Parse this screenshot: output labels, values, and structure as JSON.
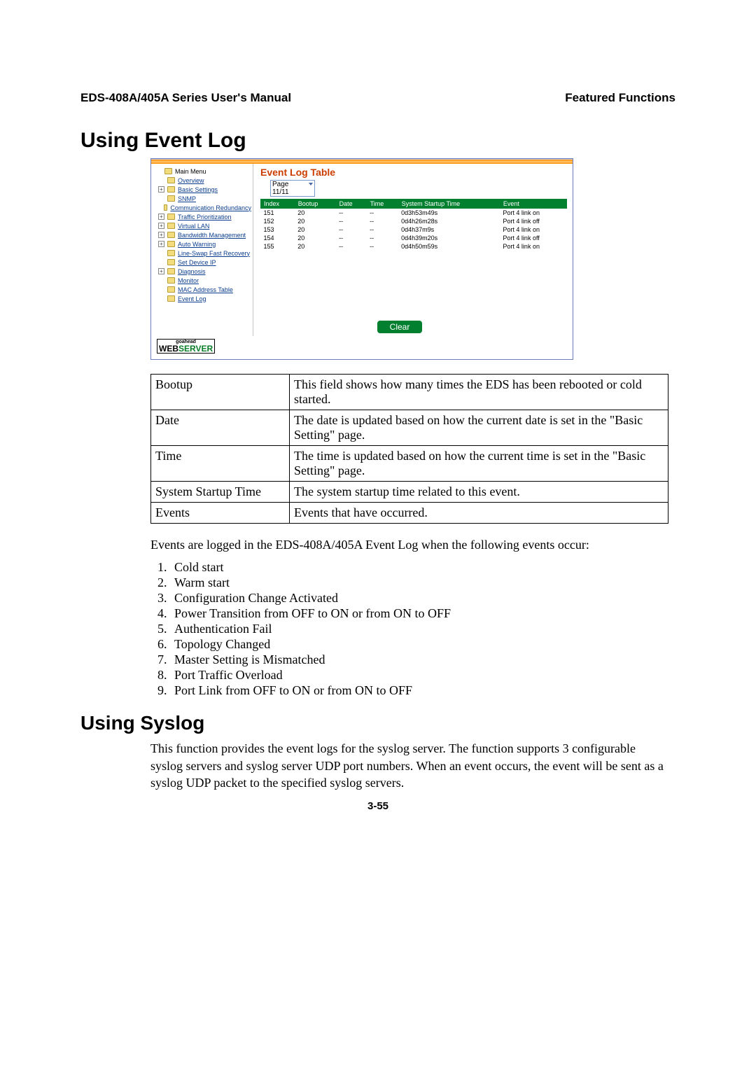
{
  "header": {
    "left": "EDS-408A/405A Series User's Manual",
    "right": "Featured Functions"
  },
  "h1": "Using Event Log",
  "screenshot": {
    "tree": [
      {
        "label": "Main Menu",
        "black": true,
        "exp": null,
        "indent": 0
      },
      {
        "label": "Overview",
        "exp": null,
        "indent": 1
      },
      {
        "label": "Basic Settings",
        "exp": "+",
        "indent": 1
      },
      {
        "label": "SNMP",
        "exp": null,
        "indent": 1
      },
      {
        "label": "Communication Redundancy",
        "exp": null,
        "indent": 1
      },
      {
        "label": "Traffic Prioritization",
        "exp": "+",
        "indent": 1
      },
      {
        "label": "Virtual LAN",
        "exp": "+",
        "indent": 1
      },
      {
        "label": "Bandwidth Management",
        "exp": "+",
        "indent": 1
      },
      {
        "label": "Auto Warning",
        "exp": "+",
        "indent": 1
      },
      {
        "label": "Line-Swap Fast Recovery",
        "exp": null,
        "indent": 1
      },
      {
        "label": "Set Device IP",
        "exp": null,
        "indent": 1
      },
      {
        "label": "Diagnosis",
        "exp": "+",
        "indent": 1
      },
      {
        "label": "Monitor",
        "exp": null,
        "indent": 1
      },
      {
        "label": "MAC Address Table",
        "exp": null,
        "indent": 1
      },
      {
        "label": "Event Log",
        "exp": null,
        "indent": 1
      }
    ],
    "title": "Event Log Table",
    "page_sel": "Page 11/11",
    "cols": [
      "Index",
      "Bootup",
      "Date",
      "Time",
      "System Startup Time",
      "Event"
    ],
    "rows": [
      {
        "Index": "151",
        "Bootup": "20",
        "Date": "--",
        "Time": "--",
        "SST": "0d3h53m49s",
        "Event": "Port 4 link on"
      },
      {
        "Index": "152",
        "Bootup": "20",
        "Date": "--",
        "Time": "--",
        "SST": "0d4h26m28s",
        "Event": "Port 4 link off"
      },
      {
        "Index": "153",
        "Bootup": "20",
        "Date": "--",
        "Time": "--",
        "SST": "0d4h37m9s",
        "Event": "Port 4 link on"
      },
      {
        "Index": "154",
        "Bootup": "20",
        "Date": "--",
        "Time": "--",
        "SST": "0d4h39m20s",
        "Event": "Port 4 link off"
      },
      {
        "Index": "155",
        "Bootup": "20",
        "Date": "--",
        "Time": "--",
        "SST": "0d4h50m59s",
        "Event": "Port 4 link on"
      }
    ],
    "clear": "Clear",
    "ws": {
      "go": "goahead",
      "a": "WEB",
      "b": "SERVER"
    }
  },
  "def": [
    {
      "k": "Bootup",
      "v": "This field shows how many times the EDS has been rebooted or cold started."
    },
    {
      "k": "Date",
      "v": "The date is updated based on how the current date is set in the \"Basic Setting\" page."
    },
    {
      "k": "Time",
      "v": "The time is updated based on how the current time is set in the \"Basic Setting\" page."
    },
    {
      "k": "System Startup Time",
      "v": "The system startup time related to this event."
    },
    {
      "k": "Events",
      "v": "Events that have occurred."
    }
  ],
  "events_intro": "Events are logged in the EDS-408A/405A Event Log when the following events occur:",
  "events": [
    "Cold start",
    "Warm start",
    "Configuration Change Activated",
    "Power Transition from OFF to ON or from ON to OFF",
    "Authentication Fail",
    "Topology Changed",
    "Master Setting is Mismatched",
    "Port Traffic Overload",
    "Port Link from OFF to ON or from ON to OFF"
  ],
  "h2": "Using Syslog",
  "syslog_body": "This function provides the event logs for the syslog server. The function supports 3 configurable syslog servers and syslog server UDP port numbers. When an event occurs, the event will be sent as a syslog UDP packet to the specified syslog servers.",
  "page_num": "3-55"
}
